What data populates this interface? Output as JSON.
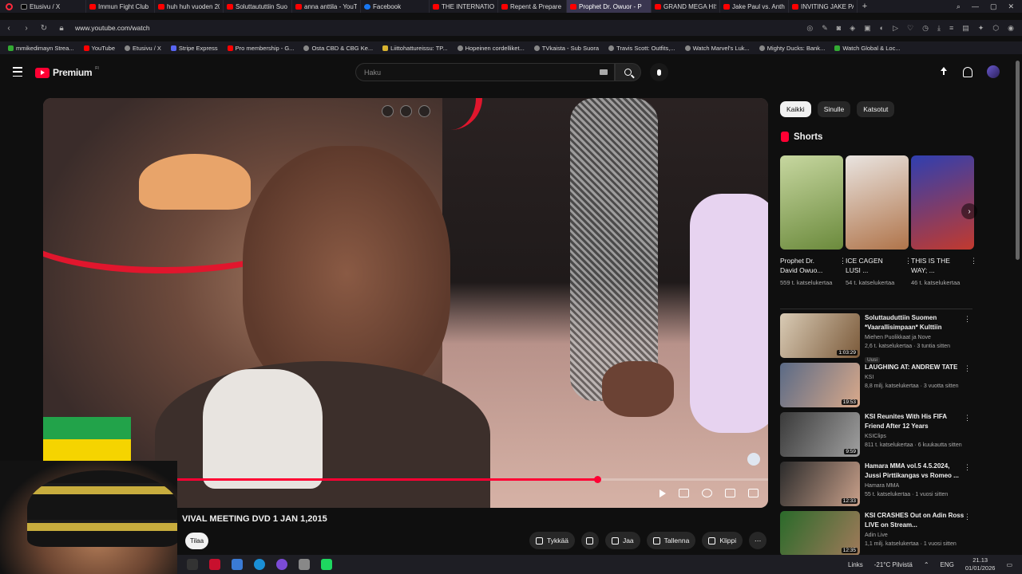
{
  "browser": {
    "tabs": [
      {
        "label": "Etusivu / X",
        "icon": "x-icon"
      },
      {
        "label": "Immun Fight Club",
        "icon": "youtube-icon"
      },
      {
        "label": "huh huh vuoden 20",
        "icon": "youtube-icon"
      },
      {
        "label": "Soluttaututtiin Suo",
        "icon": "youtube-icon"
      },
      {
        "label": "anna anttila - YouT",
        "icon": "youtube-icon"
      },
      {
        "label": "Facebook",
        "icon": "facebook-icon"
      },
      {
        "label": "THE INTERNATIONA",
        "icon": "youtube-icon"
      },
      {
        "label": "Repent & Prepare T",
        "icon": "youtube-icon"
      },
      {
        "label": "Prophet Dr. Owuor - P",
        "icon": "youtube-icon"
      },
      {
        "label": "GRAND MEGA HIST",
        "icon": "youtube-icon"
      },
      {
        "label": "Jake Paul vs. Antho",
        "icon": "youtube-icon"
      },
      {
        "label": "INVITING JAKE PAU",
        "icon": "youtube-icon"
      }
    ],
    "active_tab_index": 8,
    "url": "www.youtube.com/watch",
    "bookmarks": [
      "mmikedimayn Strea...",
      "YouTube",
      "Etusivu / X",
      "Stripe Express",
      "Pro membership - G...",
      "Osta CBD & CBG Ke...",
      "Liittohattureissu: TP...",
      "Hopeinen cordelliket...",
      "TVkaista - Sub Suora",
      "Travis Scott: Outfits,...",
      "Watch Marvel's Luk...",
      "Mighty Ducks: Bank...",
      "Watch Global & Loc..."
    ]
  },
  "header": {
    "logo_text": "Premium",
    "logo_region": "FI",
    "search_placeholder": "Haku"
  },
  "player": {
    "progress_fraction": 0.764
  },
  "video": {
    "title": "VIVAL MEETING DVD 1 JAN 1,2015",
    "subscribe_label": "Tilaa",
    "actions": {
      "like": "Tykkää",
      "share": "Jaa",
      "save": "Tallenna",
      "clip": "Klippi"
    }
  },
  "sidebar": {
    "chips": [
      "Kaikki",
      "Sinulle",
      "Katsotut"
    ],
    "selected_chip": "Kaikki",
    "shorts_heading": "Shorts",
    "shorts": [
      {
        "title": "Prophet Dr. David Owuo...",
        "views": "559 t. katselukertaa",
        "colors": [
          "#c7d7a0",
          "#6b8a3c"
        ]
      },
      {
        "title": "ICE CAGEN LUSI ...",
        "views": "54 t. katselukertaa",
        "colors": [
          "#e9e4e0",
          "#b0744a"
        ]
      },
      {
        "title": "THIS IS THE WAY; ...",
        "views": "46 t. katselukertaa",
        "colors": [
          "#2f3fb0",
          "#c23a2e"
        ]
      }
    ],
    "recommendations": [
      {
        "title": "Soluttauduttiin Suomen *Vaarallisimpaan* Kulttiin",
        "channel": "Miehen Puolikkaat ja Nove",
        "stats": "2,6 t. katselukertaa · 3 tuntia sitten",
        "badge": "Uusi",
        "duration": "1:03:29",
        "colors": [
          "#d9cbb5",
          "#7b5a3a"
        ]
      },
      {
        "title": "LAUGHING AT: ANDREW TATE",
        "channel": "KSI",
        "stats": "8,8 milj. katselukertaa · 3 vuotta sitten",
        "badge": "",
        "duration": "19:53",
        "colors": [
          "#5a6a86",
          "#d9a98a"
        ]
      },
      {
        "title": "KSI Reunites With His FIFA Friend After 12 Years",
        "channel": "KSIClips",
        "stats": "811 t. katselukertaa · 6 kuukautta sitten",
        "badge": "",
        "duration": "9:59",
        "colors": [
          "#3a3a3a",
          "#a0a0a0"
        ]
      },
      {
        "title": "Hamara MMA vol.5 4.5.2024, Jussi Pirttikangas vs Romeo ...",
        "channel": "Hamara MMA",
        "stats": "55 t. katselukertaa · 1 vuosi sitten",
        "badge": "",
        "duration": "12:33",
        "colors": [
          "#2b2b2b",
          "#c9a08a"
        ]
      },
      {
        "title": "KSI CRASHES Out on Adin Ross LIVE on Stream...",
        "channel": "Adin Live",
        "stats": "1,1 milj. katselukertaa · 1 vuosi sitten",
        "badge": "",
        "duration": "12:35",
        "colors": [
          "#2a6a2a",
          "#a07a5a"
        ]
      }
    ]
  },
  "taskbar": {
    "links_label": "Links",
    "weather": "-21°C Pilvistä",
    "language": "ENG",
    "time": "21.13",
    "date": "01/01/2026"
  }
}
